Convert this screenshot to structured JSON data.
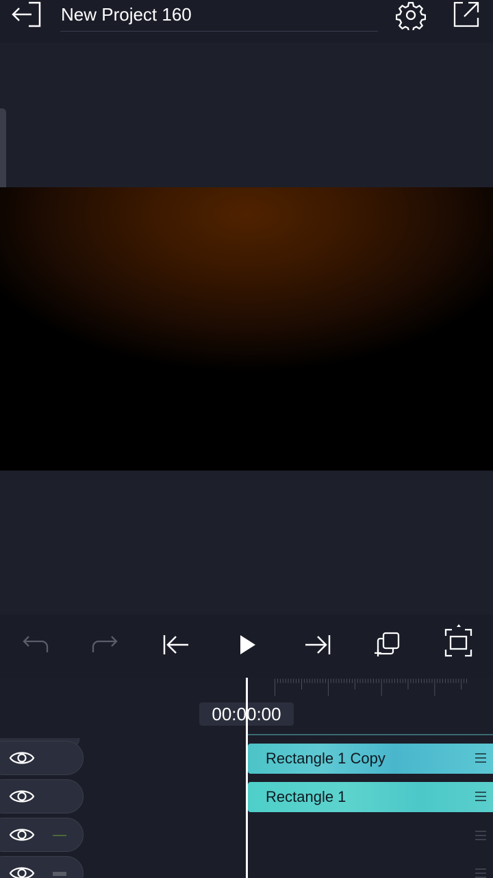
{
  "header": {
    "title": "New Project 160"
  },
  "toolbar": {
    "items": [
      "undo-icon",
      "redo-icon",
      "skip-to-start-icon",
      "play-icon",
      "skip-to-end-icon",
      "duplicate-icon",
      "fullscreen-icon"
    ]
  },
  "timeline": {
    "timecode": "00:00:00",
    "clips": [
      {
        "label": "Rectangle 1 Copy"
      },
      {
        "label": "Rectangle 1"
      }
    ]
  },
  "colors": {
    "background": "#1a1c28",
    "clip_teal": "#4cc4c7",
    "preview_glow": "#4f2200"
  }
}
